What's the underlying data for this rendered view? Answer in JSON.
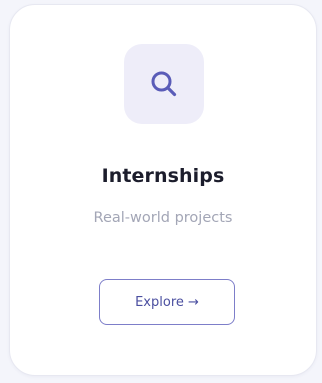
{
  "card": {
    "title": "Internships",
    "subtitle": "Real-world projects",
    "icon": "search-icon",
    "button_label": "Explore →"
  },
  "colors": {
    "page_background": "#f4f5fb",
    "card_background": "#ffffff",
    "icon_tile_background": "#eeedf9",
    "accent": "#5a5cb8",
    "title": "#1c1d2c",
    "subtitle": "#a3a6b6",
    "button_border": "#7d7ec9",
    "button_text": "#4b4fa0"
  }
}
